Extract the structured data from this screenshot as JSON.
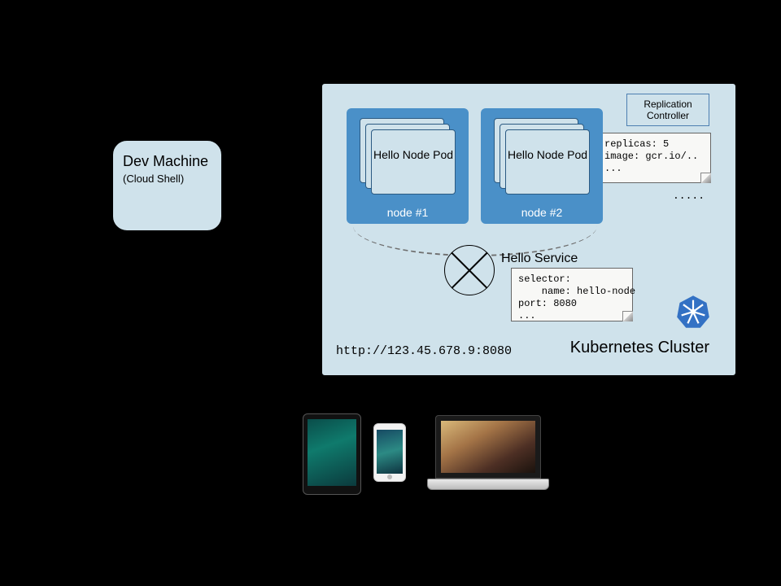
{
  "dev_machine": {
    "title": "Dev Machine",
    "subtitle": "(Cloud Shell)"
  },
  "cluster": {
    "title": "Kubernetes Cluster",
    "nodes": [
      {
        "label": "node #1",
        "pod_label": "Hello Node Pod"
      },
      {
        "label": "node #2",
        "pod_label": "Hello Node Pod"
      }
    ],
    "replication_controller": {
      "box_label": "Replication Controller",
      "yaml": "replicas: 5\nimage: gcr.io/..\n...",
      "ellipsis_below": "....."
    },
    "service": {
      "label": "Hello Service",
      "yaml": "selector:\n    name: hello-node\nport: 8080\n...",
      "url": "http://123.45.678.9:8080"
    },
    "logo": "kubernetes-logo"
  },
  "devices": {
    "tablet": "tablet",
    "phone": "phone",
    "laptop": "laptop"
  }
}
